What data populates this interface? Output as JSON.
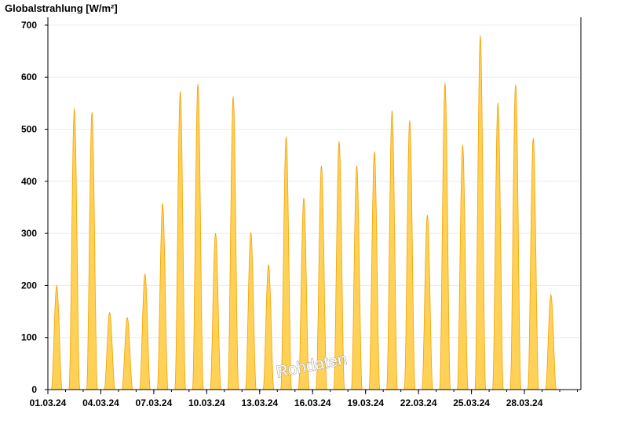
{
  "chart_data": {
    "type": "area",
    "ylabel": "Globalstrahlung [W/m²]",
    "xlabel": "",
    "ylim": [
      0,
      715
    ],
    "yticks": [
      0,
      100,
      200,
      300,
      400,
      500,
      600,
      700
    ],
    "xlim": [
      "01.03.24",
      "31.03.24"
    ],
    "xticks": [
      "01.03.24",
      "04.03.24",
      "07.03.24",
      "10.03.24",
      "13.03.24",
      "16.03.24",
      "19.03.24",
      "22.03.24",
      "25.03.24",
      "28.03.24"
    ],
    "grid": true,
    "watermark": "Rohdaten",
    "series": [
      {
        "fill_color": "#FFD257",
        "line_color": "#F5A000",
        "daily_peaks": [
          {
            "date": "01.03.24",
            "peak": 200
          },
          {
            "date": "02.03.24",
            "peak": 540
          },
          {
            "date": "03.03.24",
            "peak": 533
          },
          {
            "date": "04.03.24",
            "peak": 148
          },
          {
            "date": "05.03.24",
            "peak": 138
          },
          {
            "date": "06.03.24",
            "peak": 222
          },
          {
            "date": "07.03.24",
            "peak": 358
          },
          {
            "date": "08.03.24",
            "peak": 573
          },
          {
            "date": "09.03.24",
            "peak": 587
          },
          {
            "date": "10.03.24",
            "peak": 300
          },
          {
            "date": "11.03.24",
            "peak": 563
          },
          {
            "date": "12.03.24",
            "peak": 302
          },
          {
            "date": "13.03.24",
            "peak": 240
          },
          {
            "date": "14.03.24",
            "peak": 486
          },
          {
            "date": "15.03.24",
            "peak": 368
          },
          {
            "date": "16.03.24",
            "peak": 430
          },
          {
            "date": "17.03.24",
            "peak": 477
          },
          {
            "date": "18.03.24",
            "peak": 430
          },
          {
            "date": "19.03.24",
            "peak": 457
          },
          {
            "date": "20.03.24",
            "peak": 536
          },
          {
            "date": "21.03.24",
            "peak": 517
          },
          {
            "date": "22.03.24",
            "peak": 335
          },
          {
            "date": "23.03.24",
            "peak": 589
          },
          {
            "date": "24.03.24",
            "peak": 470
          },
          {
            "date": "25.03.24",
            "peak": 680
          },
          {
            "date": "26.03.24",
            "peak": 551
          },
          {
            "date": "27.03.24",
            "peak": 586
          },
          {
            "date": "28.03.24",
            "peak": 483
          },
          {
            "date": "29.03.24",
            "peak": 182
          }
        ]
      }
    ]
  }
}
